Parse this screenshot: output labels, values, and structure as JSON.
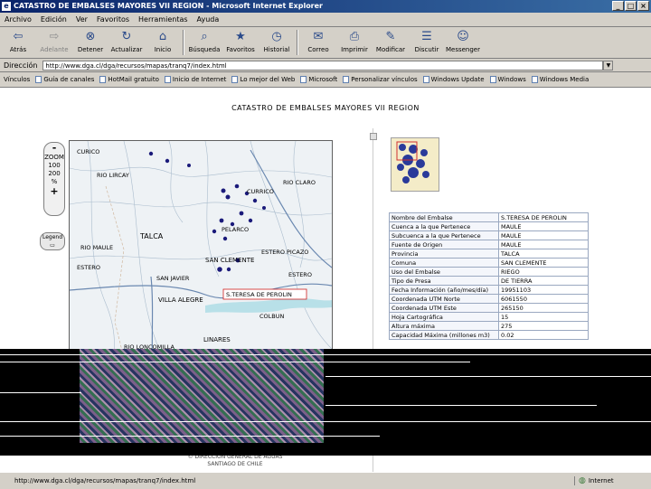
{
  "window": {
    "title": "CATASTRO DE EMBALSES MAYORES VII REGION - Microsoft Internet Explorer",
    "buttons": [
      "_",
      "□",
      "×"
    ]
  },
  "menu": [
    "Archivo",
    "Edición",
    "Ver",
    "Favoritos",
    "Herramientas",
    "Ayuda"
  ],
  "toolbar": [
    {
      "label": "Atrás",
      "icon": "back-arrow-icon",
      "disabled": false
    },
    {
      "label": "Adelante",
      "icon": "forward-arrow-icon",
      "disabled": true
    },
    {
      "label": "Detener",
      "icon": "stop-icon",
      "disabled": false
    },
    {
      "label": "Actualizar",
      "icon": "refresh-icon",
      "disabled": false
    },
    {
      "label": "Inicio",
      "icon": "home-icon",
      "disabled": false
    },
    {
      "label": "Búsqueda",
      "icon": "search-icon",
      "disabled": false
    },
    {
      "label": "Favoritos",
      "icon": "favorites-icon",
      "disabled": false
    },
    {
      "label": "Historial",
      "icon": "history-icon",
      "disabled": false
    },
    {
      "label": "Correo",
      "icon": "mail-icon",
      "disabled": false
    },
    {
      "label": "Imprimir",
      "icon": "print-icon",
      "disabled": false
    },
    {
      "label": "Modificar",
      "icon": "edit-icon",
      "disabled": false
    },
    {
      "label": "Discutir",
      "icon": "discuss-icon",
      "disabled": false
    },
    {
      "label": "Messenger",
      "icon": "messenger-icon",
      "disabled": false
    }
  ],
  "address": {
    "label": "Dirección",
    "url": "http://www.dga.cl/dga/recursos/mapas/tranq7/index.html"
  },
  "links": {
    "label": "Vínculos",
    "items": [
      "Guía de canales",
      "HotMail gratuito",
      "Inicio de Internet",
      "Lo mejor del Web",
      "Microsoft",
      "Personalizar vínculos",
      "Windows Update",
      "Windows",
      "Windows Media"
    ]
  },
  "page": {
    "title": "CATASTRO DE EMBALSES MAYORES VII REGION",
    "zoom": {
      "minus": "-",
      "label": "ZOOM",
      "levels": [
        "100",
        "200",
        "%"
      ],
      "plus": "+"
    },
    "legend_label": "Legend",
    "map_labels": {
      "l1": "CURICO",
      "l2": "CURRICO",
      "l3": "TALCA",
      "l4": "RIO MAULE",
      "l5": "PELARCO",
      "l6": "ESTERO PICAZO",
      "l7": "SAN CLEMENTE",
      "l8": "SAN JAVIER",
      "l9": "VILLA ALEGRE",
      "l10": "COLBUN",
      "l11": "LINARES",
      "l12": "RIO LIRCAY",
      "l13": "ESTERO",
      "l14": "RIO CLARO",
      "l15": "RIO LONCOMILLA",
      "l16": "ESTERO"
    },
    "selected_label": "S.TERESA DE PEROLIN",
    "info": [
      {
        "k": "Nombre del Embalse",
        "v": "S.TERESA DE PEROLIN"
      },
      {
        "k": "Cuenca a la que Pertenece",
        "v": "MAULE"
      },
      {
        "k": "Subcuenca a la que Pertenece",
        "v": "MAULE"
      },
      {
        "k": "Fuente de Origen",
        "v": "MAULE"
      },
      {
        "k": "Provincia",
        "v": "TALCA"
      },
      {
        "k": "Comuna",
        "v": "SAN CLEMENTE"
      },
      {
        "k": "Uso del Embalse",
        "v": "RIEGO"
      },
      {
        "k": "Tipo de Presa",
        "v": "DE TIERRA"
      },
      {
        "k": "Fecha Información (año/mes/día)",
        "v": "19951103"
      },
      {
        "k": "Coordenada UTM Norte",
        "v": "6061550"
      },
      {
        "k": "Coordenada UTM Este",
        "v": "265150"
      },
      {
        "k": "Hoja Cartográfica",
        "v": "15"
      },
      {
        "k": "Altura máxima",
        "v": "275"
      },
      {
        "k": "Capacidad Máxima (millones m3)",
        "v": "0.02"
      }
    ],
    "footer": [
      "© DIRECCION GENERAL DE AGUAS",
      "SANTIAGO DE CHILE"
    ]
  },
  "status": {
    "text": "http://www.dga.cl/dga/recursos/mapas/tranq7/index.html",
    "zone": "Internet"
  }
}
